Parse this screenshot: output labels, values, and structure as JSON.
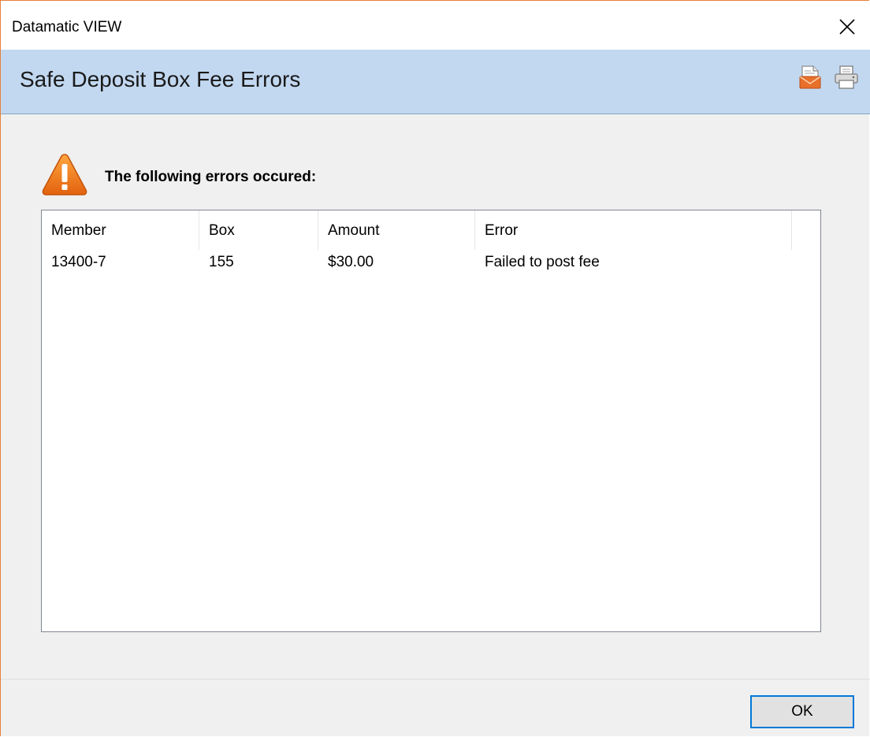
{
  "window": {
    "title": "Datamatic VIEW"
  },
  "banner": {
    "heading": "Safe Deposit Box Fee Errors",
    "email_icon": "email-report-icon",
    "print_icon": "printer-icon"
  },
  "message": {
    "icon": "warning-icon",
    "text": "The following errors occured:"
  },
  "table": {
    "columns": [
      "Member",
      "Box",
      "Amount",
      "Error"
    ],
    "rows": [
      {
        "member": "13400-7",
        "box": "155",
        "amount": "$30.00",
        "error": "Failed to post fee"
      }
    ]
  },
  "footer": {
    "ok_label": "OK"
  },
  "colors": {
    "banner": "#c2d8f0",
    "window_border": "#e8803a",
    "ok_focus": "#0078d7"
  }
}
